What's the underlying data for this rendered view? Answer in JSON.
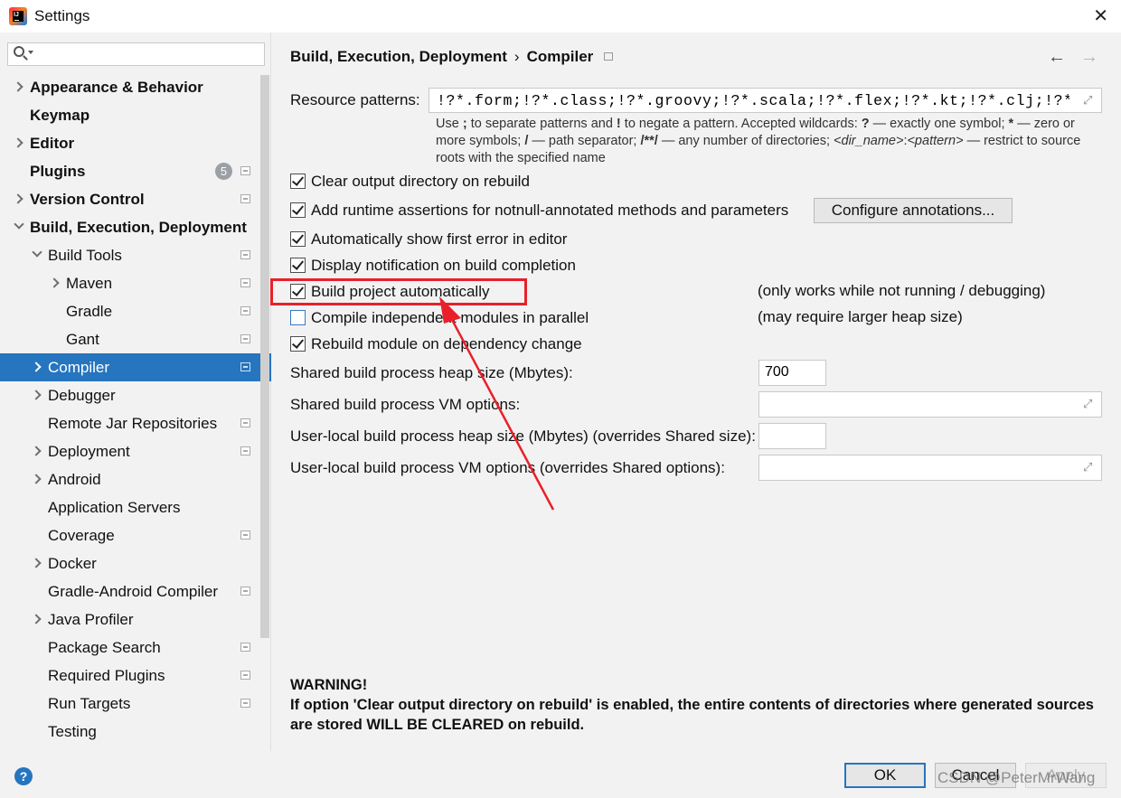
{
  "window": {
    "title": "Settings"
  },
  "search": {
    "placeholder": "",
    "value": ""
  },
  "sidebar": {
    "items": [
      {
        "label": "Appearance & Behavior"
      },
      {
        "label": "Keymap"
      },
      {
        "label": "Editor"
      },
      {
        "label": "Plugins",
        "badge": "5"
      },
      {
        "label": "Version Control"
      },
      {
        "label": "Build, Execution, Deployment"
      },
      {
        "label": "Build Tools"
      },
      {
        "label": "Maven"
      },
      {
        "label": "Gradle"
      },
      {
        "label": "Gant"
      },
      {
        "label": "Compiler"
      },
      {
        "label": "Debugger"
      },
      {
        "label": "Remote Jar Repositories"
      },
      {
        "label": "Deployment"
      },
      {
        "label": "Android"
      },
      {
        "label": "Application Servers"
      },
      {
        "label": "Coverage"
      },
      {
        "label": "Docker"
      },
      {
        "label": "Gradle-Android Compiler"
      },
      {
        "label": "Java Profiler"
      },
      {
        "label": "Package Search"
      },
      {
        "label": "Required Plugins"
      },
      {
        "label": "Run Targets"
      },
      {
        "label": "Testing"
      }
    ]
  },
  "breadcrumb": {
    "parent": "Build, Execution, Deployment",
    "separator": "›",
    "current": "Compiler"
  },
  "compiler": {
    "resource_patterns_label": "Resource patterns:",
    "resource_patterns_value": "!?*.form;!?*.class;!?*.groovy;!?*.scala;!?*.flex;!?*.kt;!?*.clj;!?*.aj",
    "hint": {
      "p1": "Use ",
      "b1": ";",
      "p2": " to separate patterns and ",
      "b2": "!",
      "p3": " to negate a pattern. Accepted wildcards: ",
      "b3": "?",
      "p4": " — exactly one symbol; ",
      "b4": "*",
      "p5": " — zero or more symbols; ",
      "b5": "/",
      "p6": " — path separator; ",
      "b6": "/**/",
      "p7": " — any number of directories; ",
      "i1": "<dir_name>",
      "p8": ":",
      "i2": "<pattern>",
      "p9": " — restrict to source roots with the specified name"
    },
    "options": [
      {
        "label": "Clear output directory on rebuild",
        "checked": true
      },
      {
        "label": "Add runtime assertions for notnull-annotated methods and parameters",
        "checked": true
      },
      {
        "label": "Automatically show first error in editor",
        "checked": true
      },
      {
        "label": "Display notification on build completion",
        "checked": true
      },
      {
        "label": "Build project automatically",
        "checked": true,
        "note": "(only works while not running / debugging)"
      },
      {
        "label": "Compile independent modules in parallel",
        "checked": false,
        "note": "(may require larger heap size)"
      },
      {
        "label": "Rebuild module on dependency change",
        "checked": true
      }
    ],
    "configure_annotations_label": "Configure annotations...",
    "heap_size_label": "Shared build process heap size (Mbytes):",
    "heap_size_value": "700",
    "vm_options_label": "Shared build process VM options:",
    "vm_options_value": "",
    "user_heap_label": "User-local build process heap size (Mbytes) (overrides Shared size):",
    "user_heap_value": "",
    "user_vm_label": "User-local build process VM options (overrides Shared options):",
    "user_vm_value": "",
    "warning_title": "WARNING!",
    "warning_text": "If option 'Clear output directory on rebuild' is enabled, the entire contents of directories where generated sources are stored WILL BE CLEARED on rebuild."
  },
  "footer": {
    "ok_label": "OK",
    "cancel_label": "Cancel",
    "apply_label": "Apply",
    "watermark": "CSDN @PeterMrWang"
  },
  "colors": {
    "accent": "#2675bf",
    "highlight": "#e8202a",
    "background": "#f2f2f2"
  }
}
